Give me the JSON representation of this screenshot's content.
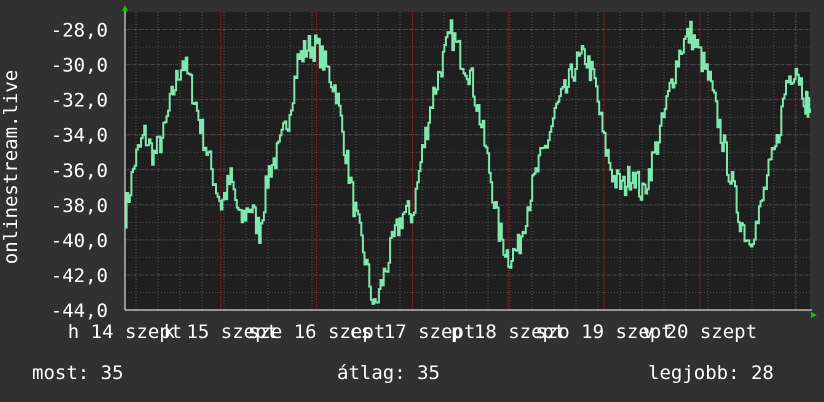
{
  "chart_data": {
    "type": "line",
    "ylabel": "onlinestream.live",
    "ylim": [
      -44,
      -27
    ],
    "y_ticks": [
      "-28,0",
      "-30,0",
      "-32,0",
      "-34,0",
      "-36,0",
      "-38,0",
      "-40,0",
      "-42,0",
      "-44,0"
    ],
    "x_tick_labels": [
      "h 14 szept",
      "k 15 szept",
      "sze 16 szept",
      "cs 17 szept",
      "p 18 szept",
      "szo 19 szept",
      "v 20 szept"
    ],
    "grid": true,
    "series": [
      {
        "color": "#7fe8b0",
        "x": [
          0,
          0.1,
          0.2,
          0.3,
          0.4,
          0.5,
          0.6,
          0.7,
          0.8,
          0.9,
          1.0,
          1.1,
          1.2,
          1.3,
          1.4,
          1.5,
          1.6,
          1.7,
          1.8,
          1.9,
          2.0,
          2.1,
          2.2,
          2.3,
          2.4,
          2.5,
          2.6,
          2.7,
          2.8,
          2.9,
          3.0,
          3.1,
          3.2,
          3.3,
          3.4,
          3.5,
          3.6,
          3.7,
          3.8,
          3.9,
          4.0,
          4.1,
          4.2,
          4.3,
          4.4,
          4.5,
          4.6,
          4.7,
          4.8,
          4.9,
          5.0,
          5.1,
          5.2,
          5.3,
          5.4,
          5.5,
          5.6,
          5.7,
          5.8,
          5.9,
          6.0,
          6.1,
          6.2,
          6.3,
          6.4,
          6.5,
          6.6,
          6.7,
          6.8,
          6.9,
          7.0,
          7.1,
          7.15
        ],
        "values": [
          -38.5,
          -35.5,
          -34.0,
          -35.2,
          -34.0,
          -31.5,
          -29.7,
          -31.5,
          -33.8,
          -36.0,
          -38.0,
          -36.5,
          -39.0,
          -38.0,
          -39.5,
          -36.0,
          -35.0,
          -33.0,
          -29.8,
          -29.0,
          -29.0,
          -30.2,
          -31.5,
          -35.0,
          -38.5,
          -41.0,
          -44.0,
          -42.0,
          -40.0,
          -38.5,
          -38.5,
          -35.0,
          -32.0,
          -30.0,
          -28.2,
          -29.5,
          -30.5,
          -33.0,
          -36.0,
          -39.5,
          -41.0,
          -40.5,
          -38.0,
          -36.0,
          -34.5,
          -32.5,
          -31.5,
          -30.0,
          -29.5,
          -31.0,
          -34.5,
          -36.5,
          -37.0,
          -36.0,
          -37.5,
          -35.5,
          -33.5,
          -31.0,
          -29.0,
          -28.2,
          -29.5,
          -31.0,
          -33.5,
          -36.0,
          -38.5,
          -40.0,
          -39.0,
          -36.5,
          -34.5,
          -31.0,
          -30.0,
          -32.0,
          -32.5
        ],
        "noise_seed": 7
      }
    ]
  },
  "footer": {
    "now": "most: 35",
    "avg": "átlag: 35",
    "max": "legjobb: 28"
  }
}
